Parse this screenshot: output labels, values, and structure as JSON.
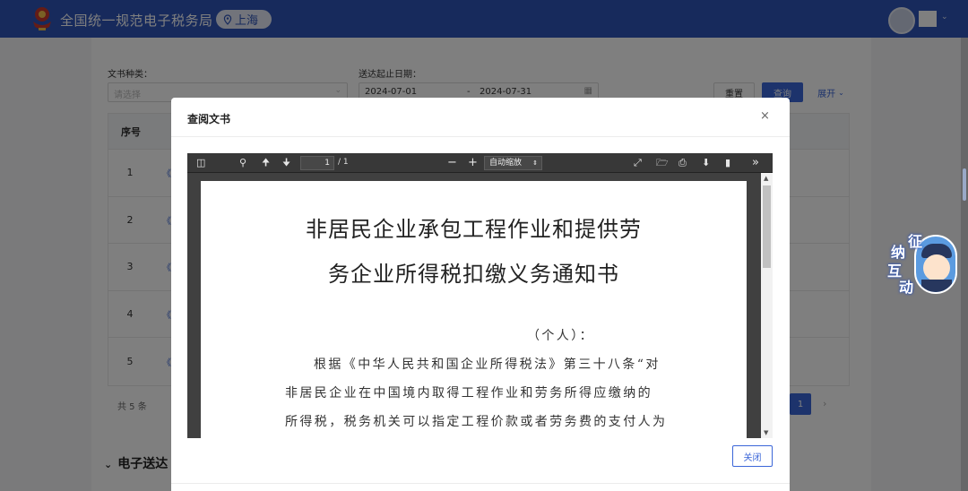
{
  "header": {
    "app_title": "全国统一规范电子税务局",
    "region": "上海",
    "region_icon": "location-pin-icon"
  },
  "filters": {
    "doc_type_label": "文书种类：",
    "doc_type_placeholder": "请选择",
    "date_label": "送达起止日期：",
    "date_start": "2024-07-01",
    "date_sep": "-",
    "date_end": "2024-07-31",
    "reset_label": "重置",
    "query_label": "查询",
    "expand_label": "展开"
  },
  "table": {
    "header_index": "序号",
    "rows": [
      {
        "index": "1",
        "link": "《"
      },
      {
        "index": "2",
        "link": "《"
      },
      {
        "index": "3",
        "link": "《"
      },
      {
        "index": "4",
        "link": "《"
      },
      {
        "index": "5",
        "link": "《"
      }
    ],
    "total": "共 5 条",
    "current_page": "1",
    "next": "›"
  },
  "section_title": "电子送达",
  "assistant": {
    "chars": [
      "征",
      "纳",
      "互",
      "动"
    ]
  },
  "modal": {
    "title": "查阅文书",
    "close_icon": "×",
    "close_button": "关闭",
    "viewer": {
      "page_current": "1",
      "page_total": "/ 1",
      "zoom": "自动缩放",
      "icons": [
        "sidebar-toggle-icon",
        "search-icon",
        "prev-page-icon",
        "next-page-icon",
        "zoom-out-icon",
        "zoom-in-icon",
        "presentation-icon",
        "open-file-icon",
        "print-icon",
        "download-icon",
        "bookmark-icon",
        "more-tools-icon"
      ]
    },
    "document": {
      "title_line1": "非居民企业承包工程作业和提供劳",
      "title_line2": "务企业所得税扣缴义务通知书",
      "addressee": "（个人）：",
      "body_line1": "根据《中华人民共和国企业所得税法》第三十八条“对",
      "body_line2": "非居民企业在中国境内取得工程作业和劳务所得应缴纳的",
      "body_line3": "所得税，税务机关可以指定工程价款或者劳务费的支付人为"
    }
  }
}
